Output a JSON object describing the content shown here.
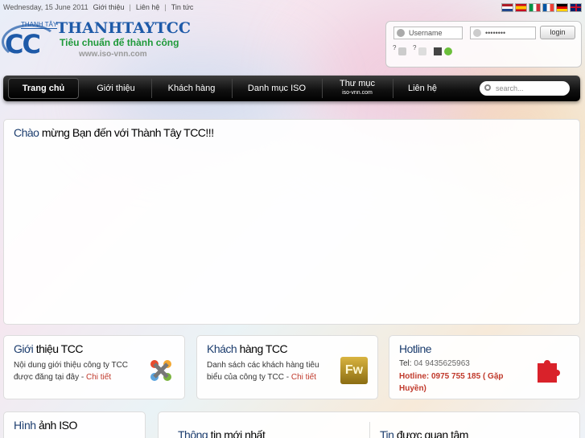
{
  "topbar": {
    "date": "Wednesday, 15 June 2011",
    "links": [
      "Giới thiệu",
      "Liên hệ",
      "Tin tức"
    ]
  },
  "flags": [
    "Nederlands",
    "Español",
    "Italiano",
    "Français",
    "Deutsch",
    "English"
  ],
  "logo": {
    "small_text": "THANH TÂY",
    "mark": "CC",
    "brand": "THANHTAYTCC",
    "slogan": "Tiêu chuẩn để thành công",
    "url": "www.iso-vnn.com"
  },
  "login": {
    "username_placeholder": "Username",
    "password_value": "••••••••",
    "button": "login",
    "mini_q1": "?",
    "mini_q2": "?"
  },
  "nav": {
    "items": [
      "Trang chủ",
      "Giới thiệu",
      "Khách hàng",
      "Danh mục ISO",
      "Thư mục",
      "Liên hệ"
    ],
    "thu_muc_sub": "iso-vnn.com",
    "search_placeholder": "search..."
  },
  "welcome": {
    "title_prefix": "Chào ",
    "title_rest": "mừng Bạn đến với Thành Tây TCC!!!"
  },
  "box_intro": {
    "title_a": "Giới ",
    "title_b": "thiệu TCC",
    "text1": "Nội dung giới thiệu công ty TCC",
    "text2": "được đăng tại đây - ",
    "more": "Chi tiết"
  },
  "box_clients": {
    "title_a": "Khách ",
    "title_b": "hàng TCC",
    "text1": "Danh sách các khách hàng tiêu",
    "text2": "biểu của công ty TCC - ",
    "more": "Chi tiết",
    "icon_label": "Fw"
  },
  "box_hotline": {
    "title": "Hotline",
    "tel_label": "Tel: ",
    "tel": "04 9435625963",
    "hotline1": "Hotline: 0975 755 185 ( Gặp",
    "hotline2": "Huyền)"
  },
  "box_images": {
    "title_a": "Hình ",
    "title_b": "ảnh ISO"
  },
  "box_news": {
    "title_a": "Thông ",
    "title_b": "tin mới nhất",
    "title2_a": "Tin ",
    "title2_b": "được quan tâm"
  },
  "colors": {
    "brand_blue": "#1e5aa8",
    "slogan_green": "#1f9a3a",
    "accent_red": "#c0392b",
    "nav_black": "#000000"
  },
  "icons": [
    "user-icon",
    "key-icon",
    "joomla-icon",
    "fireworks-icon",
    "puzzle-icon",
    "search-icon"
  ]
}
